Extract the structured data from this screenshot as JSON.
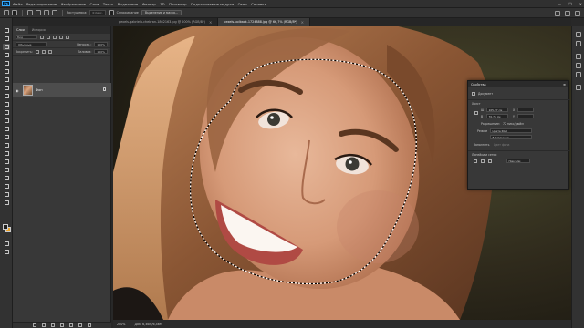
{
  "menu": {
    "app_logo": "Ps",
    "items": [
      "Файл",
      "Редактирование",
      "Изображение",
      "Слои",
      "Текст",
      "Выделение",
      "Фильтр",
      "3D",
      "Просмотр",
      "Подключаемые модули",
      "Окно",
      "Справка"
    ],
    "win_controls": [
      "—",
      "❐",
      "✕"
    ]
  },
  "options": {
    "feather_label": "Растушевка:",
    "feather_value": "0 пикс.",
    "antialias_label": "Сглаживание",
    "select_mask_button": "Выделение и маска..."
  },
  "tabs": [
    {
      "label": "pexels-gabriela-chebran-1862163.jpg @ 200% (RGB/8*)",
      "active": true
    },
    {
      "label": "pexels-polback-1724888.jpg @ 66,7% (RGB/8*)",
      "active": false
    }
  ],
  "layers_panel": {
    "tabs": [
      "Слои",
      "История"
    ],
    "filter_placeholder": "Вид",
    "blend_mode": "Обычные",
    "opacity_label": "Непрозр.:",
    "opacity_value": "100%",
    "lock_label": "Закрепить:",
    "fill_label": "Заливка:",
    "fill_value": "100%",
    "layers": [
      {
        "name": "Фон",
        "visible": true,
        "locked": true
      }
    ]
  },
  "status": {
    "zoom": "200%",
    "doc_info": "Док: 6,46M/6,46M"
  },
  "properties": {
    "title": "Свойства",
    "doc_label": "Документ",
    "section_canvas": "Холст",
    "width_label": "Ш",
    "width_value": "105,27 см",
    "height_label": "В",
    "height_value": "70,75 см",
    "x_label": "X",
    "y_label": "Y",
    "resolution_label": "Разрешение:",
    "resolution_value": "72 пикс/дюйм",
    "mode_label": "Режим",
    "mode_value": "Цвета RGB",
    "depth_value": "8 бит/канал",
    "bg_label": "Заполнить",
    "bg_value": "Цвет фона",
    "section_rulers": "Линейки и сетки",
    "units_value": "Пиксели"
  }
}
